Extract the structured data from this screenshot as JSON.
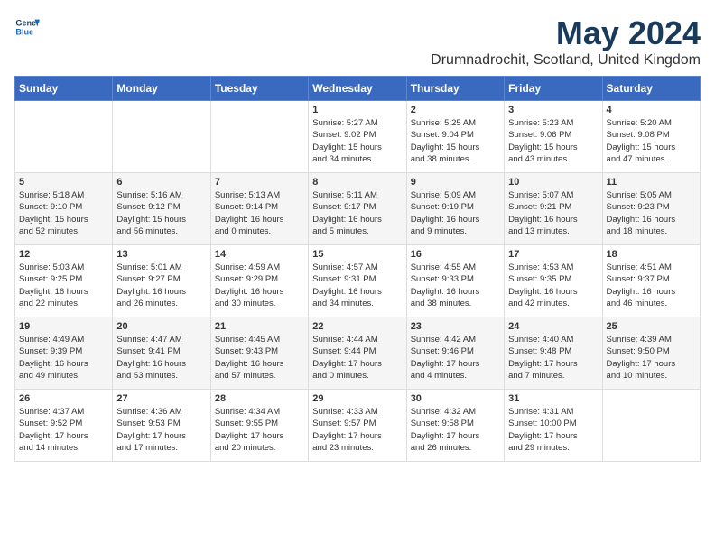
{
  "logo": {
    "line1": "General",
    "line2": "Blue"
  },
  "title": "May 2024",
  "subtitle": "Drumnadrochit, Scotland, United Kingdom",
  "days_of_week": [
    "Sunday",
    "Monday",
    "Tuesday",
    "Wednesday",
    "Thursday",
    "Friday",
    "Saturday"
  ],
  "weeks": [
    [
      {
        "day": "",
        "info": ""
      },
      {
        "day": "",
        "info": ""
      },
      {
        "day": "",
        "info": ""
      },
      {
        "day": "1",
        "info": "Sunrise: 5:27 AM\nSunset: 9:02 PM\nDaylight: 15 hours\nand 34 minutes."
      },
      {
        "day": "2",
        "info": "Sunrise: 5:25 AM\nSunset: 9:04 PM\nDaylight: 15 hours\nand 38 minutes."
      },
      {
        "day": "3",
        "info": "Sunrise: 5:23 AM\nSunset: 9:06 PM\nDaylight: 15 hours\nand 43 minutes."
      },
      {
        "day": "4",
        "info": "Sunrise: 5:20 AM\nSunset: 9:08 PM\nDaylight: 15 hours\nand 47 minutes."
      }
    ],
    [
      {
        "day": "5",
        "info": "Sunrise: 5:18 AM\nSunset: 9:10 PM\nDaylight: 15 hours\nand 52 minutes."
      },
      {
        "day": "6",
        "info": "Sunrise: 5:16 AM\nSunset: 9:12 PM\nDaylight: 15 hours\nand 56 minutes."
      },
      {
        "day": "7",
        "info": "Sunrise: 5:13 AM\nSunset: 9:14 PM\nDaylight: 16 hours\nand 0 minutes."
      },
      {
        "day": "8",
        "info": "Sunrise: 5:11 AM\nSunset: 9:17 PM\nDaylight: 16 hours\nand 5 minutes."
      },
      {
        "day": "9",
        "info": "Sunrise: 5:09 AM\nSunset: 9:19 PM\nDaylight: 16 hours\nand 9 minutes."
      },
      {
        "day": "10",
        "info": "Sunrise: 5:07 AM\nSunset: 9:21 PM\nDaylight: 16 hours\nand 13 minutes."
      },
      {
        "day": "11",
        "info": "Sunrise: 5:05 AM\nSunset: 9:23 PM\nDaylight: 16 hours\nand 18 minutes."
      }
    ],
    [
      {
        "day": "12",
        "info": "Sunrise: 5:03 AM\nSunset: 9:25 PM\nDaylight: 16 hours\nand 22 minutes."
      },
      {
        "day": "13",
        "info": "Sunrise: 5:01 AM\nSunset: 9:27 PM\nDaylight: 16 hours\nand 26 minutes."
      },
      {
        "day": "14",
        "info": "Sunrise: 4:59 AM\nSunset: 9:29 PM\nDaylight: 16 hours\nand 30 minutes."
      },
      {
        "day": "15",
        "info": "Sunrise: 4:57 AM\nSunset: 9:31 PM\nDaylight: 16 hours\nand 34 minutes."
      },
      {
        "day": "16",
        "info": "Sunrise: 4:55 AM\nSunset: 9:33 PM\nDaylight: 16 hours\nand 38 minutes."
      },
      {
        "day": "17",
        "info": "Sunrise: 4:53 AM\nSunset: 9:35 PM\nDaylight: 16 hours\nand 42 minutes."
      },
      {
        "day": "18",
        "info": "Sunrise: 4:51 AM\nSunset: 9:37 PM\nDaylight: 16 hours\nand 46 minutes."
      }
    ],
    [
      {
        "day": "19",
        "info": "Sunrise: 4:49 AM\nSunset: 9:39 PM\nDaylight: 16 hours\nand 49 minutes."
      },
      {
        "day": "20",
        "info": "Sunrise: 4:47 AM\nSunset: 9:41 PM\nDaylight: 16 hours\nand 53 minutes."
      },
      {
        "day": "21",
        "info": "Sunrise: 4:45 AM\nSunset: 9:43 PM\nDaylight: 16 hours\nand 57 minutes."
      },
      {
        "day": "22",
        "info": "Sunrise: 4:44 AM\nSunset: 9:44 PM\nDaylight: 17 hours\nand 0 minutes."
      },
      {
        "day": "23",
        "info": "Sunrise: 4:42 AM\nSunset: 9:46 PM\nDaylight: 17 hours\nand 4 minutes."
      },
      {
        "day": "24",
        "info": "Sunrise: 4:40 AM\nSunset: 9:48 PM\nDaylight: 17 hours\nand 7 minutes."
      },
      {
        "day": "25",
        "info": "Sunrise: 4:39 AM\nSunset: 9:50 PM\nDaylight: 17 hours\nand 10 minutes."
      }
    ],
    [
      {
        "day": "26",
        "info": "Sunrise: 4:37 AM\nSunset: 9:52 PM\nDaylight: 17 hours\nand 14 minutes."
      },
      {
        "day": "27",
        "info": "Sunrise: 4:36 AM\nSunset: 9:53 PM\nDaylight: 17 hours\nand 17 minutes."
      },
      {
        "day": "28",
        "info": "Sunrise: 4:34 AM\nSunset: 9:55 PM\nDaylight: 17 hours\nand 20 minutes."
      },
      {
        "day": "29",
        "info": "Sunrise: 4:33 AM\nSunset: 9:57 PM\nDaylight: 17 hours\nand 23 minutes."
      },
      {
        "day": "30",
        "info": "Sunrise: 4:32 AM\nSunset: 9:58 PM\nDaylight: 17 hours\nand 26 minutes."
      },
      {
        "day": "31",
        "info": "Sunrise: 4:31 AM\nSunset: 10:00 PM\nDaylight: 17 hours\nand 29 minutes."
      },
      {
        "day": "",
        "info": ""
      }
    ]
  ]
}
